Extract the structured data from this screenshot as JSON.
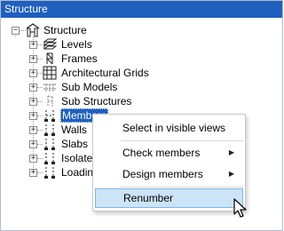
{
  "panel": {
    "title": "Structure"
  },
  "tree": {
    "root": {
      "label": "Structure",
      "expander": "−"
    },
    "items": [
      {
        "label": "Levels",
        "expander": "+",
        "icon": "levels-icon"
      },
      {
        "label": "Frames",
        "expander": "+",
        "icon": "frames-icon"
      },
      {
        "label": "Architectural Grids",
        "expander": "+",
        "icon": "grid-icon"
      },
      {
        "label": "Sub Models",
        "expander": "+",
        "icon": "sub-models-icon"
      },
      {
        "label": "Sub Structures",
        "expander": "+",
        "icon": "sub-structures-icon"
      },
      {
        "label": "Members",
        "expander": "+",
        "icon": "members-icon",
        "selected": true
      },
      {
        "label": "Walls",
        "expander": "+",
        "icon": "walls-icon"
      },
      {
        "label": "Slabs",
        "expander": "+",
        "icon": "slabs-icon"
      },
      {
        "label": "Isolated",
        "expander": "+",
        "icon": "isolated-icon"
      },
      {
        "label": "Loading",
        "expander": "+",
        "icon": "loading-icon"
      }
    ]
  },
  "context_menu": {
    "items": [
      {
        "label": "Select in visible views",
        "submenu": false
      },
      {
        "label": "Check members",
        "submenu": true
      },
      {
        "label": "Design members",
        "submenu": true
      },
      {
        "label": "Renumber",
        "submenu": false,
        "hovered": true
      }
    ],
    "submenu_arrow": "▶"
  },
  "colors": {
    "title_bar": "#1f5fbf",
    "selection": "#1f5fbf",
    "menu_hover": "#cce4f7",
    "menu_hover_border": "#7eb4ea"
  }
}
